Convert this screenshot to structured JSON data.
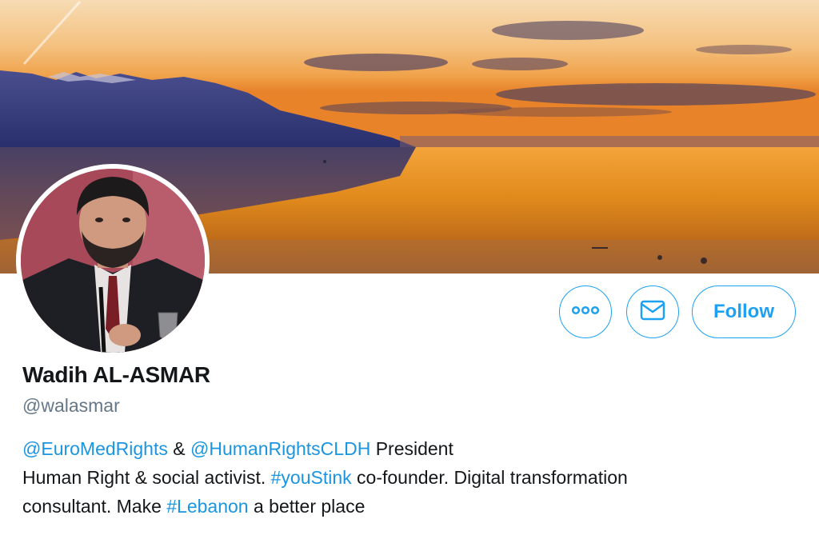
{
  "profile": {
    "name": "Wadih AL-ASMAR",
    "handle": "@walasmar",
    "bio": {
      "line1": [
        {
          "text": "@EuroMedRights",
          "type": "mention"
        },
        {
          "text": " & ",
          "type": "text"
        },
        {
          "text": "@HumanRightsCLDH",
          "type": "mention"
        },
        {
          "text": " President",
          "type": "text"
        }
      ],
      "line2": [
        {
          "text": "Human Right & social activist. ",
          "type": "text"
        },
        {
          "text": "#youStink",
          "type": "hashtag"
        },
        {
          "text": " co-founder. Digital transformation",
          "type": "text"
        }
      ],
      "line3": [
        {
          "text": "consultant. Make ",
          "type": "text"
        },
        {
          "text": "#Lebanon",
          "type": "hashtag"
        },
        {
          "text": " a better place",
          "type": "text"
        }
      ]
    }
  },
  "actions": {
    "more_icon": "more-dots-icon",
    "message_icon": "envelope-icon",
    "follow_label": "Follow"
  },
  "colors": {
    "accent": "#1da1f2",
    "link": "#1b95e0",
    "secondary_text": "#657786"
  }
}
